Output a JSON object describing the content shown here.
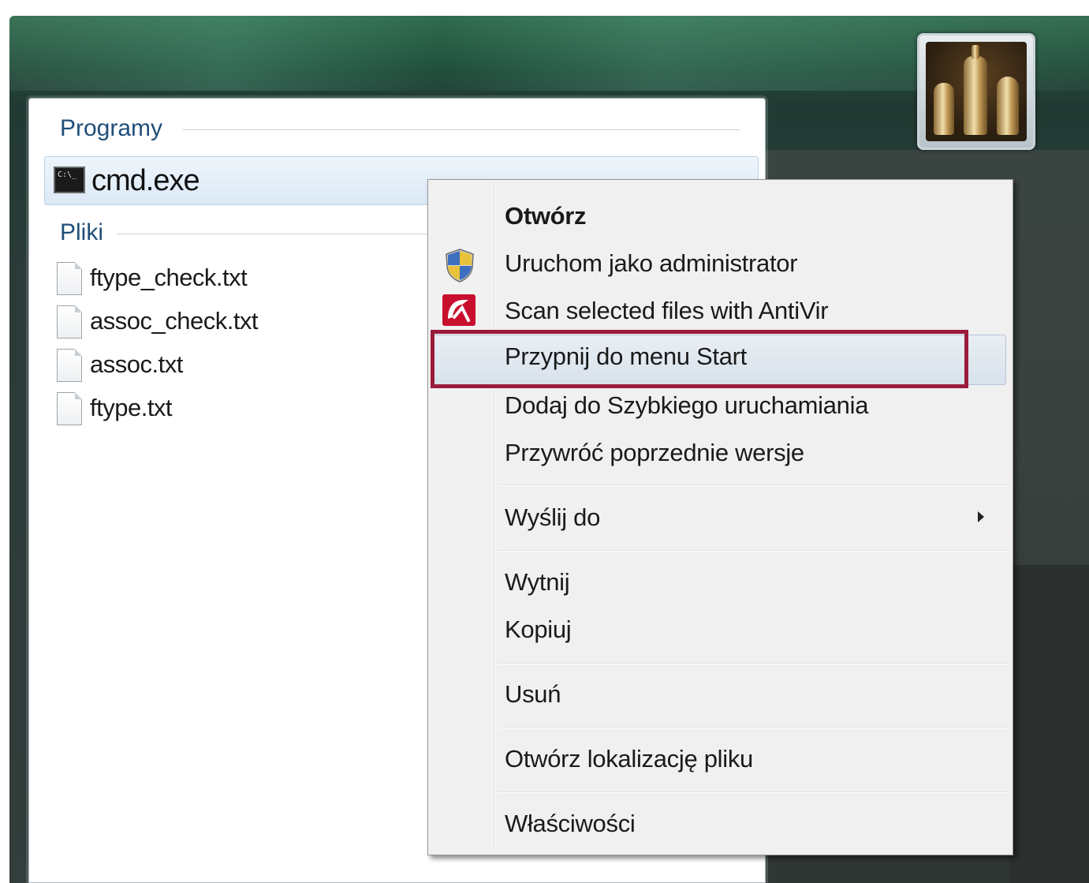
{
  "programs_pane": {
    "programs_heading": "Programy",
    "files_heading": "Pliki",
    "program_item": {
      "label": "cmd.exe",
      "icon": "console-icon"
    },
    "files": [
      {
        "label": "ftype_check.txt",
        "icon": "text-file-icon"
      },
      {
        "label": "assoc_check.txt",
        "icon": "text-file-icon"
      },
      {
        "label": "assoc.txt",
        "icon": "text-file-icon"
      },
      {
        "label": "ftype.txt",
        "icon": "text-file-icon"
      }
    ]
  },
  "user_picture": {
    "icon": "chess-pieces-icon"
  },
  "context_menu": {
    "items": [
      {
        "label": "Otwórz",
        "default": true
      },
      {
        "label": "Uruchom jako administrator",
        "icon": "uac-shield-icon"
      },
      {
        "label": "Scan selected files with AntiVir",
        "icon": "antivir-umbrella-icon"
      },
      {
        "label": "Przypnij do menu Start",
        "highlighted": true
      },
      {
        "label": "Dodaj do Szybkiego uruchamiania"
      },
      {
        "label": "Przywróć poprzednie wersje"
      },
      {
        "label": "Wyślij do",
        "submenu": true
      },
      {
        "label": "Wytnij"
      },
      {
        "label": "Kopiuj"
      },
      {
        "label": "Usuń"
      },
      {
        "label": "Otwórz lokalizację pliku"
      },
      {
        "label": "Właściwości"
      }
    ],
    "highlight_color": "#9b1b3b"
  }
}
